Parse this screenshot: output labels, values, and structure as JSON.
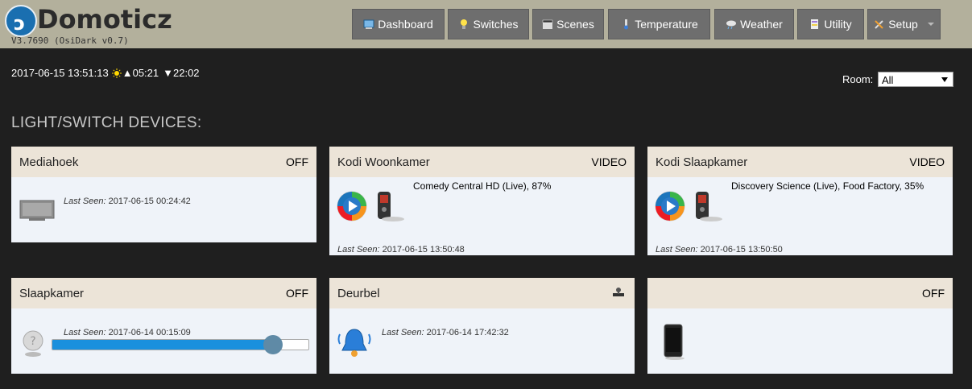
{
  "header": {
    "brand": "Domoticz",
    "version": "V3.7690 (OsiDark v0.7)",
    "nav": [
      {
        "label": "Dashboard",
        "icon": "dashboard-icon"
      },
      {
        "label": "Switches",
        "icon": "lightbulb-icon"
      },
      {
        "label": "Scenes",
        "icon": "clapperboard-icon"
      },
      {
        "label": "Temperature",
        "icon": "thermometer-icon"
      },
      {
        "label": "Weather",
        "icon": "cloud-rain-icon"
      },
      {
        "label": "Utility",
        "icon": "utility-icon"
      },
      {
        "label": "Setup",
        "icon": "tools-icon"
      }
    ]
  },
  "status": {
    "datetime": "2017-06-15 13:51:13",
    "sunrise": "▲05:21",
    "sunset": "▼22:02"
  },
  "room": {
    "label": "Room:",
    "value": "All"
  },
  "section_title": "LIGHT/SWITCH DEVICES:",
  "devices": [
    {
      "name": "Mediahoek",
      "status": "OFF",
      "last_seen_label": "Last Seen:",
      "last_seen": "2017-06-15 00:24:42",
      "icon": "tv-icon"
    },
    {
      "name": "Kodi Woonkamer",
      "status": "VIDEO",
      "now_playing": "Comedy Central HD (Live), 87%",
      "last_seen_label": "Last Seen:",
      "last_seen": "2017-06-15 13:50:48",
      "icon": "media-player-icon"
    },
    {
      "name": "Kodi Slaapkamer",
      "status": "VIDEO",
      "now_playing": "Discovery Science (Live), Food Factory, 35%",
      "last_seen_label": "Last Seen:",
      "last_seen": "2017-06-15 13:50:50",
      "icon": "media-player-icon"
    },
    {
      "name": "Slaapkamer",
      "status": "OFF",
      "last_seen_label": "Last Seen:",
      "last_seen": "2017-06-14 00:15:09",
      "icon": "bulb-icon",
      "dim_level": 0.86
    },
    {
      "name": "Deurbel",
      "status": "",
      "last_seen_label": "Last Seen:",
      "last_seen": "2017-06-14 17:42:32",
      "icon": "doorbell-icon"
    },
    {
      "name": "",
      "status": "OFF",
      "icon": "phone-icon"
    }
  ],
  "colors": {
    "header_bg": "#b3b09c",
    "page_bg": "#1f1f1f",
    "card_head": "#ece4d8",
    "card_body": "#eff3f9",
    "slider_fill": "#1a90dd"
  }
}
